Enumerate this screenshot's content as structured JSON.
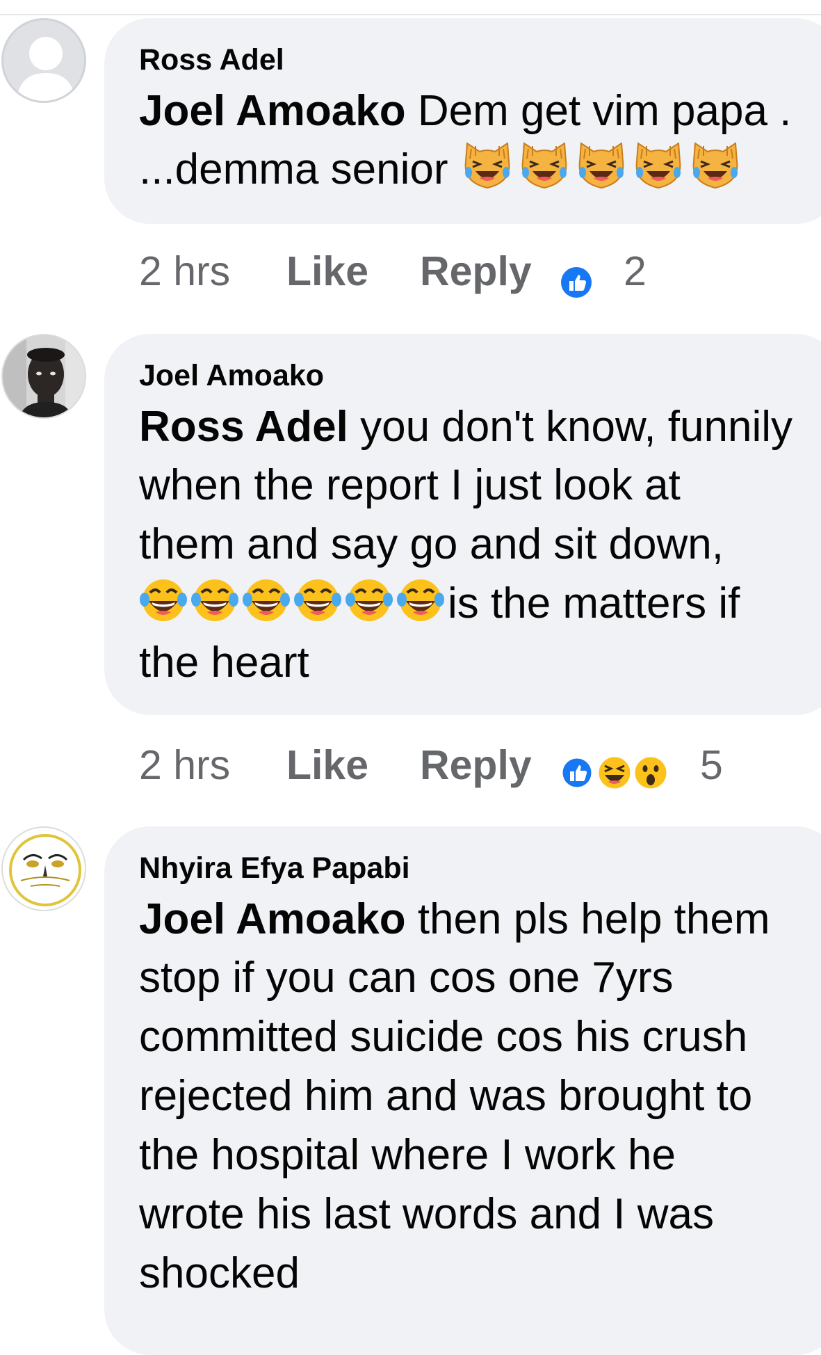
{
  "comments": [
    {
      "author": "Ross Adel",
      "mention": "Joel Amoako",
      "line1": " Dem get vim papa .",
      "line2": "...demma senior",
      "time": "2 hrs",
      "like": "Like",
      "reply": "Reply",
      "reaction_count": "2",
      "reactions": [
        "like-reaction"
      ],
      "emojis": [
        "cat-tears-of-joy",
        "cat-tears-of-joy",
        "cat-tears-of-joy",
        "cat-tears-of-joy",
        "cat-tears-of-joy"
      ]
    },
    {
      "author": "Joel Amoako",
      "mention": "Ross Adel",
      "line1": " you don't know, funnily",
      "line2": "when the report I just look at",
      "line3": "them and say go and sit down,",
      "line4": "is the matters if",
      "line5": "the heart",
      "time": "2 hrs",
      "like": "Like",
      "reply": "Reply",
      "reaction_count": "5",
      "reactions": [
        "like-reaction",
        "haha-reaction",
        "wow-reaction"
      ],
      "emojis": [
        "tears-of-joy",
        "tears-of-joy",
        "tears-of-joy",
        "tears-of-joy",
        "tears-of-joy",
        "tears-of-joy"
      ]
    },
    {
      "author": "Nhyira Efya Papabi",
      "mention": "Joel Amoako",
      "line1": " then pls help them",
      "line2": "stop if you can cos one 7yrs",
      "line3": "committed suicide cos his crush",
      "line4": "rejected him and was brought to",
      "line5": "the hospital where I work he",
      "line6": "wrote his last words and I was",
      "line7": "shocked"
    }
  ],
  "colors": {
    "bubble": "#f0f2f5",
    "text": "#050505",
    "meta": "#65676b",
    "like_blue": "#1877f2",
    "emoji_yellow": "#fcc21b"
  }
}
